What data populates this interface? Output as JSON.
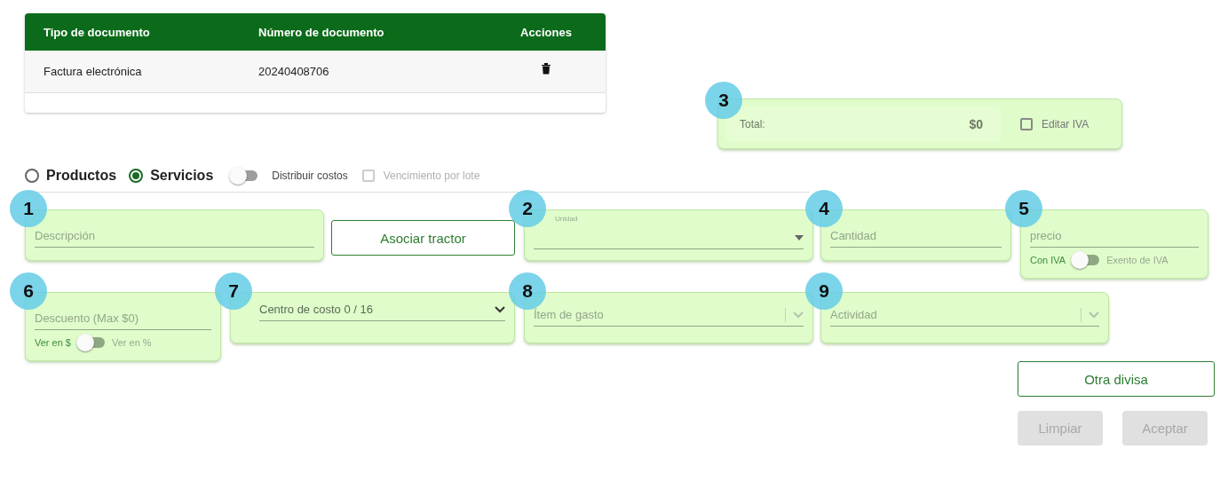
{
  "table": {
    "columns": [
      "Tipo de documento",
      "Número de documento",
      "Acciones"
    ],
    "rows": [
      {
        "cells": [
          "Factura electrónica",
          "20240408706"
        ]
      }
    ]
  },
  "total_card": {
    "badge": "3",
    "label": "Total:",
    "value": "$0",
    "edit_vat": {
      "label": "Editar IVA",
      "checked": false
    }
  },
  "options": {
    "radios": [
      {
        "label": "Productos",
        "selected": false
      },
      {
        "label": "Servicios",
        "selected": true
      }
    ],
    "toggle": {
      "label": "Distribuir costos",
      "on": false
    },
    "checkbox": {
      "label": "Vencimiento por lote",
      "checked": false,
      "disabled": true
    }
  },
  "fields_row_1": [
    {
      "kind": "text",
      "badge": "1",
      "placeholder": "Descripción"
    },
    {
      "kind": "button",
      "label": "Asociar tractor"
    },
    {
      "kind": "dropdown",
      "badge": "2",
      "label": "Unidad"
    },
    {
      "kind": "text",
      "badge": "4",
      "placeholder": "Cantidad"
    },
    {
      "kind": "text",
      "badge": "5",
      "placeholder": "precio",
      "switch": {
        "left": "Con IVA",
        "right": "Exento de IVA",
        "on": false
      }
    }
  ],
  "fields_row_2": [
    {
      "kind": "text",
      "badge": "6",
      "placeholder": "Descuento (Max $0)",
      "switch": {
        "left": "Ver en $",
        "right": "Ver en %",
        "on": false
      }
    },
    {
      "kind": "select",
      "badge": "7",
      "value": "Centro de costo 0 / 16"
    },
    {
      "kind": "combo",
      "badge": "8",
      "placeholder": "Ítem de gasto"
    },
    {
      "kind": "combo",
      "badge": "9",
      "placeholder": "Actividad"
    }
  ],
  "buttons": [
    {
      "label": "Otra divisa",
      "disabled": false
    },
    {
      "label": "Limpiar",
      "disabled": true
    },
    {
      "label": "Aceptar",
      "disabled": true
    }
  ]
}
